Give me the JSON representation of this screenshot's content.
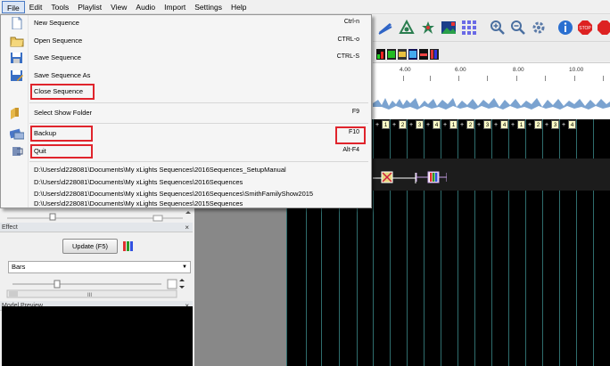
{
  "menubar": {
    "items": [
      "File",
      "Edit",
      "Tools",
      "Playlist",
      "View",
      "Audio",
      "Import",
      "Settings",
      "Help"
    ]
  },
  "file_menu": {
    "items": [
      {
        "label": "New Sequence",
        "shortcut": "Ctrl-n",
        "icon": "new-document-icon"
      },
      {
        "label": "Open Sequence",
        "shortcut": "CTRL-o",
        "icon": "open-folder-icon"
      },
      {
        "label": "Save Sequence",
        "shortcut": "CTRL-S",
        "icon": "save-icon"
      },
      {
        "label": "Save Sequence As",
        "shortcut": "",
        "icon": "save-as-icon"
      },
      {
        "label": "Close Sequence",
        "shortcut": "",
        "icon": ""
      },
      {
        "label": "Select Show Folder",
        "shortcut": "F9",
        "icon": "folder-icon"
      },
      {
        "label": "Backup",
        "shortcut": "F10",
        "icon": "backup-icon"
      },
      {
        "label": "Quit",
        "shortcut": "Alt-F4",
        "icon": "quit-icon"
      }
    ],
    "recent": [
      "D:\\Users\\d228081\\Documents\\My xLights Sequences\\2016Sequences_SetupManual",
      "D:\\Users\\d228081\\Documents\\My xLights Sequences\\2016Sequences",
      "D:\\Users\\d228081\\Documents\\My xLights Sequences\\2016Sequences\\SmithFamilyShow2015",
      "D:\\Users\\d228081\\Documents\\My xLights Sequences\\2015Sequences"
    ],
    "highlight_color": "#e0242c"
  },
  "timeline": {
    "ticks": [
      "4.00",
      "6.00",
      "8.00",
      "10.00"
    ]
  },
  "beats": [
    "1",
    "2",
    "3",
    "4",
    "1",
    "2",
    "3",
    "4",
    "1",
    "2",
    "3",
    "4"
  ],
  "effect_panel": {
    "title": "Effect",
    "close": "×",
    "update_label": "Update (F5)",
    "effect_select": "Bars"
  },
  "model_preview": {
    "title": "Model Preview",
    "close": "×"
  },
  "toolbar_icons": [
    "pen-icon",
    "fan-icon",
    "star-icon",
    "picture-icon",
    "grid-icon",
    "zoom-in-icon",
    "zoom-out-icon",
    "gear-icon",
    "info-icon",
    "stop-icon",
    "stop-icon-2"
  ]
}
